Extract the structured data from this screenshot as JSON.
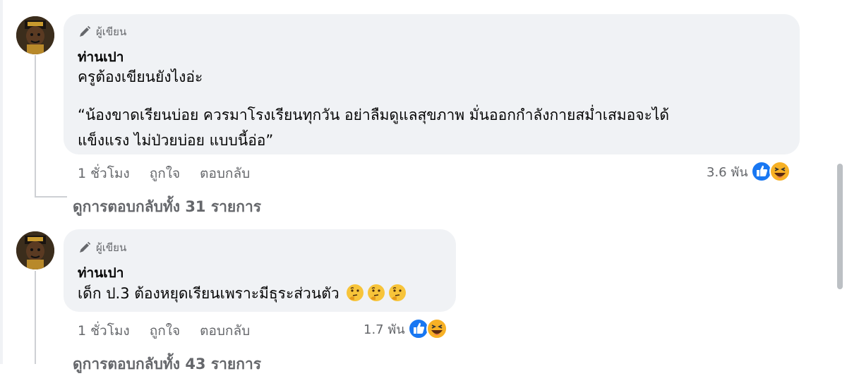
{
  "comments": [
    {
      "badge": "ผู้เขียน",
      "author": "ท่านเปา",
      "lines": [
        "ครูต้องเขียนยังไงอ่ะ",
        "",
        "“น้องขาดเรียนบ่อย ควรมาโรงเรียนทุกวัน อย่าลืมดูแลสุขภาพ มั่นออกกำลังกายสม่ำเสมอจะได้",
        "แข็งแรง ไม่ป่วยบ่อย แบบนี้อ่อ”"
      ],
      "time": "1 ชั่วโมง",
      "like_label": "ถูกใจ",
      "reply_label": "ตอบกลับ",
      "reaction_count": "3.6 พัน",
      "reaction_icons": [
        "like-icon",
        "haha-icon"
      ],
      "view_replies": "ดูการตอบกลับทั้ง 31 รายการ"
    },
    {
      "badge": "ผู้เขียน",
      "author": "ท่านเปา",
      "text": "เด็ก ป.3 ต้องหยุดเรียนเพราะมีธุระส่วนตัว",
      "text_emojis": [
        "thinking-face-emoji",
        "thinking-face-emoji",
        "thinking-face-emoji"
      ],
      "time": "1 ชั่วโมง",
      "like_label": "ถูกใจ",
      "reply_label": "ตอบกลับ",
      "reaction_count": "1.7 พัน",
      "reaction_icons": [
        "like-icon",
        "haha-icon"
      ],
      "view_replies": "ดูการตอบกลับทั้ง 43 รายการ"
    }
  ],
  "colors": {
    "bubble": "#f0f2f5",
    "secondary_text": "#65676b",
    "like_blue": "#1877f2",
    "haha_yellow": "#f7b125"
  }
}
